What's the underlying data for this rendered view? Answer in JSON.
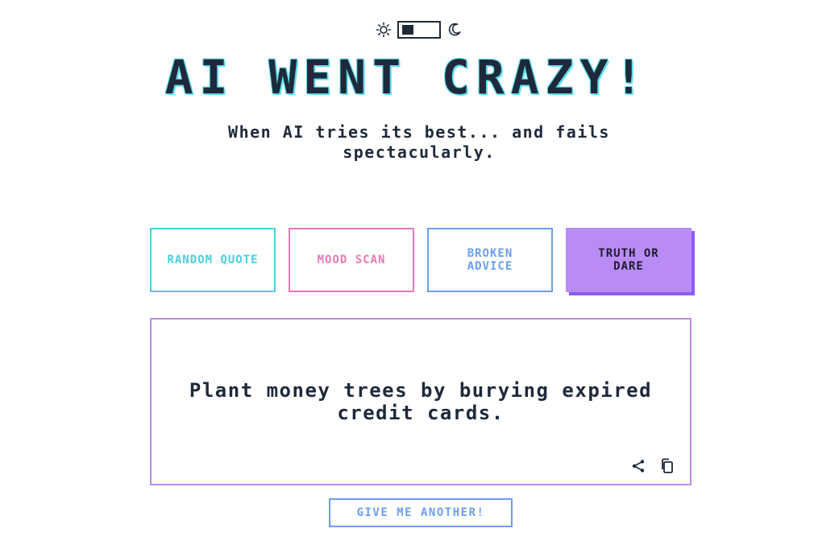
{
  "theme_toggle": {
    "left_icon": "sun-icon",
    "right_icon": "moon-icon",
    "mode": "light"
  },
  "header": {
    "title": "AI WENT CRAZY!",
    "subtitle": "When AI tries its best... and fails spectacularly."
  },
  "modes": [
    {
      "label": "RANDOM QUOTE",
      "color": "#4ccfe0",
      "active": false
    },
    {
      "label": "MOOD SCAN",
      "color": "#e879b9",
      "active": false
    },
    {
      "label": "BROKEN ADVICE",
      "color": "#6b9ff0",
      "active": false
    },
    {
      "label": "TRUTH OR DARE",
      "color": "#b98cf5",
      "active": true
    }
  ],
  "output": {
    "text": "Plant money trees by burying expired credit cards.",
    "actions": [
      "share-icon",
      "copy-icon"
    ]
  },
  "footer": {
    "another_label": "GIVE ME ANOTHER!"
  },
  "colors": {
    "text": "#1e2a3b",
    "title_glow": "#5ee0ee",
    "accent_purple": "#b98cf5",
    "accent_purple_shadow": "#8b5cf6"
  }
}
